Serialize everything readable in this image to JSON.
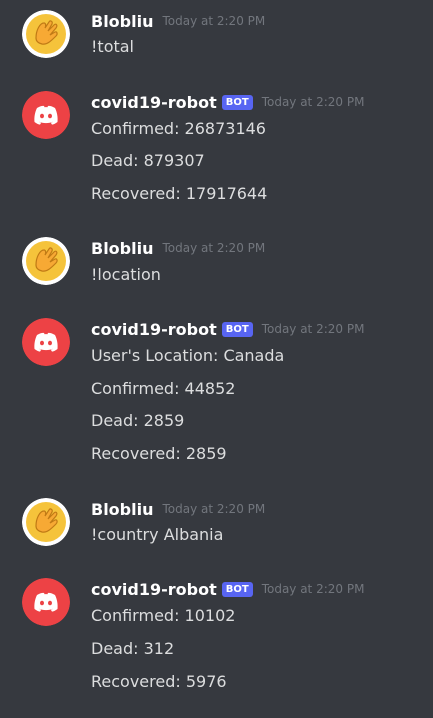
{
  "messages": [
    {
      "author": "Blobliu",
      "avatar_icon": "waving-hand-emoji-icon",
      "is_bot": false,
      "timestamp": "Today at 2:20 PM",
      "lines": [
        "!total"
      ]
    },
    {
      "author": "covid19-robot",
      "avatar_icon": "discord-logo-icon",
      "is_bot": true,
      "bot_label": "BOT",
      "timestamp": "Today at 2:20 PM",
      "lines": [
        "Confirmed: 26873146",
        "Dead: 879307",
        "Recovered: 17917644"
      ]
    },
    {
      "author": "Blobliu",
      "avatar_icon": "waving-hand-emoji-icon",
      "is_bot": false,
      "timestamp": "Today at 2:20 PM",
      "lines": [
        "!location"
      ]
    },
    {
      "author": "covid19-robot",
      "avatar_icon": "discord-logo-icon",
      "is_bot": true,
      "bot_label": "BOT",
      "timestamp": "Today at 2:20 PM",
      "lines": [
        "User's Location: Canada",
        "Confirmed: 44852",
        "Dead: 2859",
        "Recovered: 2859"
      ]
    },
    {
      "author": "Blobliu",
      "avatar_icon": "waving-hand-emoji-icon",
      "is_bot": false,
      "timestamp": "Today at 2:20 PM",
      "lines": [
        "!country Albania"
      ]
    },
    {
      "author": "covid19-robot",
      "avatar_icon": "discord-logo-icon",
      "is_bot": true,
      "bot_label": "BOT",
      "timestamp": "Today at 2:20 PM",
      "lines": [
        "Confirmed: 10102",
        "Dead: 312",
        "Recovered: 5976"
      ]
    }
  ],
  "colors": {
    "background": "#36393f",
    "username": "#ffffff",
    "text": "#dcddde",
    "timestamp": "#72767d",
    "bot_badge": "#5865f2",
    "bot_avatar": "#ed4245",
    "emoji_avatar": "#f5c33b"
  }
}
